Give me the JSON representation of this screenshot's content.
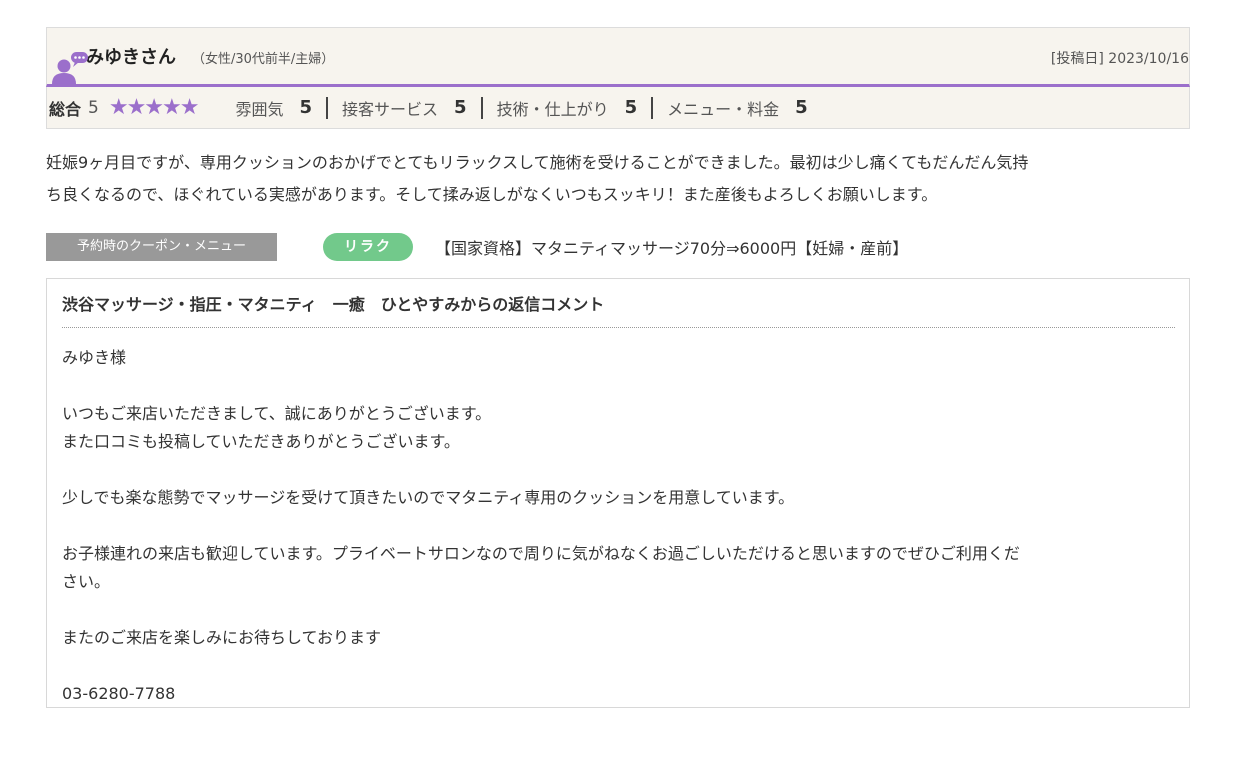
{
  "review": {
    "user_name": "みゆきさん",
    "user_meta": "（女性/30代前半/主婦）",
    "post_date": "[投稿日] 2023/10/16",
    "overall_label": "総合",
    "overall_value": "5",
    "stars": "★★★★★",
    "star_rating": 5,
    "ratings": [
      {
        "label": "雰囲気",
        "value": "5"
      },
      {
        "label": "接客サービス",
        "value": "5"
      },
      {
        "label": "技術・仕上がり",
        "value": "5"
      },
      {
        "label": "メニュー・料金",
        "value": "5"
      }
    ],
    "body_line1": "妊娠9ヶ月目ですが、専用クッションのおかげでとてもリラックスして施術を受けることができました。最初は少し痛くてもだんだん気持",
    "body_line2": "ち良くなるので、ほぐれている実感があります。そして揉み返しがなくいつもスッキリ！また産後もよろしくお願いします。"
  },
  "coupon": {
    "label": "予約時のクーポン・メニュー",
    "tag": "リラク",
    "menu": "【国家資格】マタニティマッサージ70分⇒6000円【妊婦・産前】"
  },
  "reply": {
    "title": "渋谷マッサージ・指圧・マタニティ　一癒　ひとやすみからの返信コメント",
    "lines": [
      "みゆき様",
      "",
      "いつもご来店いただきまして、誠にありがとうございます。",
      "また口コミも投稿していただきありがとうございます。",
      "",
      "少しでも楽な態勢でマッサージを受けて頂きたいのでマタニティ専用のクッションを用意しています。",
      "",
      "お子様連れの来店も歓迎しています。プライベートサロンなので周りに気がねなくお過ごしいただけると思いますのでぜひご利用くだ",
      "さい。",
      "",
      "またのご来店を楽しみにお待ちしております",
      "",
      "03-6280-7788"
    ]
  },
  "colors": {
    "accent": "#9b6fcb",
    "tag_green": "#72c98b",
    "header_bg": "#f7f4ee",
    "coupon_label_bg": "#999999"
  },
  "icons": {
    "avatar": "user-comment-icon",
    "star": "star-icon"
  }
}
